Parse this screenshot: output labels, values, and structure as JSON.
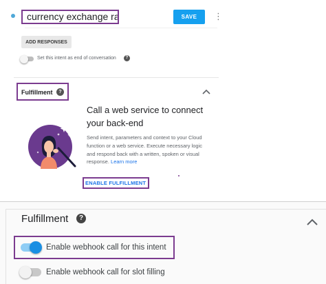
{
  "intent": {
    "name": "currency exchange rate",
    "save_label": "SAVE",
    "more_icon": "more-vert-icon"
  },
  "responses": {
    "add_responses_label": "ADD RESPONSES",
    "end_of_conversation_label": "Set this intent as end of conversation",
    "end_of_conversation_on": false
  },
  "fulfillment": {
    "title": "Fulfillment",
    "heading": "Call a web service to connect your back-end",
    "body": "Send intent, parameters and context to your Cloud function or a web service. Execute necessary logic and respond back with a written, spoken or visual response.",
    "learn_more": "Learn more",
    "enable_label": "ENABLE FULFILLMENT"
  },
  "fulfillment_expanded": {
    "title": "Fulfillment",
    "webhook_intent_label": "Enable webhook call for this intent",
    "webhook_intent_on": true,
    "webhook_slot_label": "Enable webhook call for slot filling",
    "webhook_slot_on": false
  },
  "colors": {
    "accent_blue": "#16a0ef",
    "link_blue": "#1a73e8",
    "highlight_purple": "#7b3b8f",
    "illustration_purple": "#6a3a8e"
  }
}
